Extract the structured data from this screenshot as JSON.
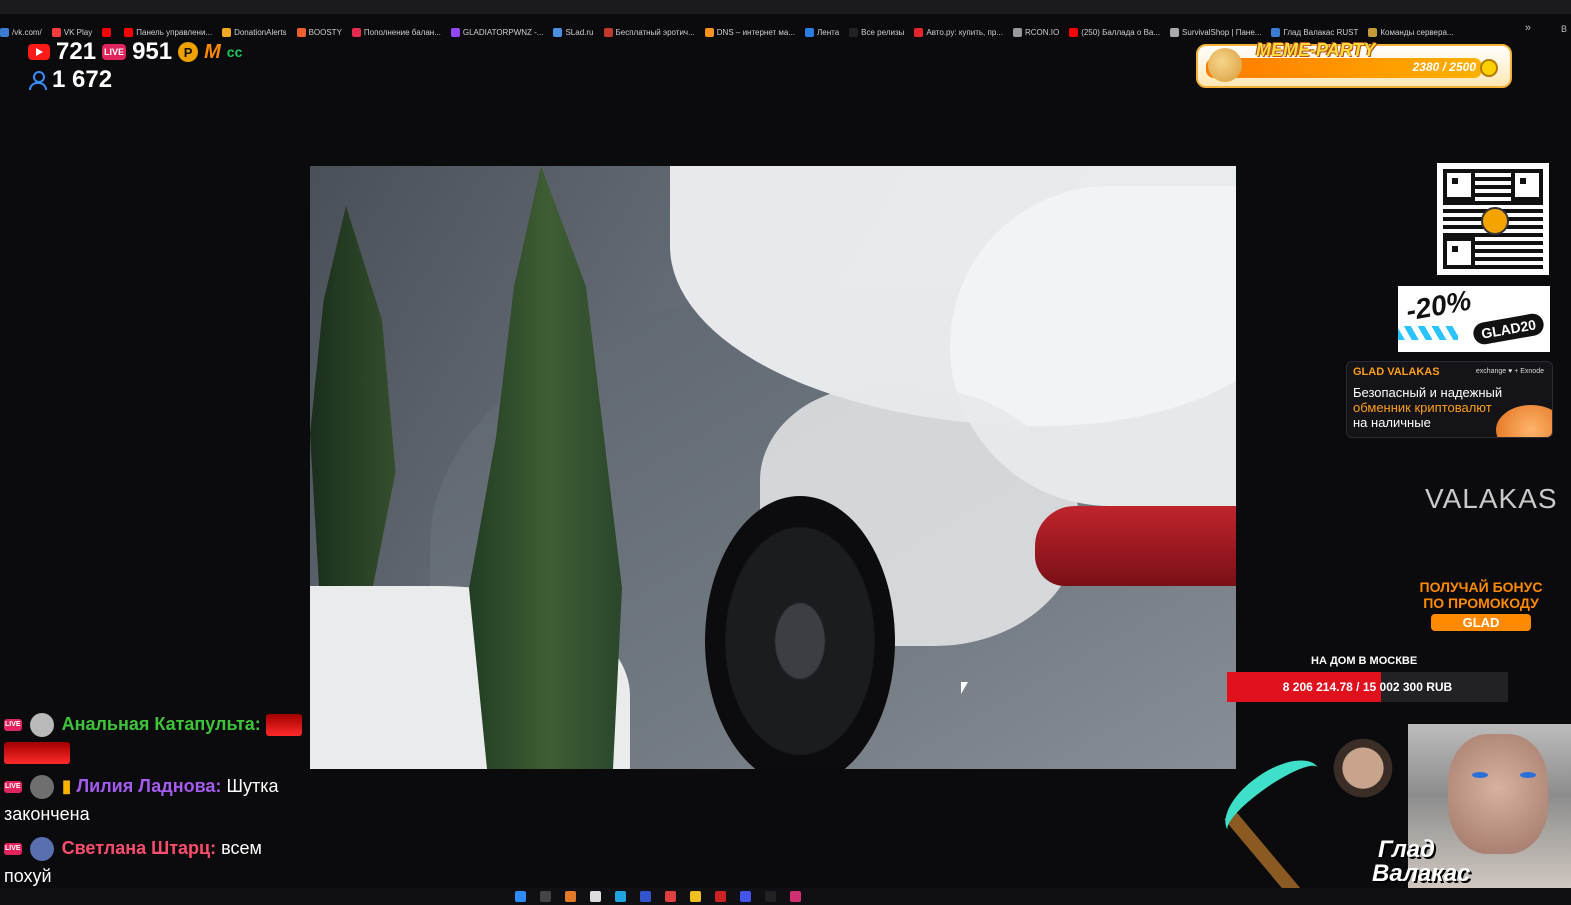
{
  "bookmarks": [
    {
      "label": "/vk.com/",
      "color": "#3a7bd5"
    },
    {
      "label": "VK Play",
      "color": "#ff3b3b"
    },
    {
      "label": "",
      "color": "#ff0000"
    },
    {
      "label": "Панель управлени...",
      "color": "#ff0000"
    },
    {
      "label": "DonationAlerts",
      "color": "#f5a623"
    },
    {
      "label": "BOOSTY",
      "color": "#f15f2c"
    },
    {
      "label": "Пополнение балан...",
      "color": "#e52b50"
    },
    {
      "label": "GLADIATORPWNZ -...",
      "color": "#9146ff"
    },
    {
      "label": "SLad.ru",
      "color": "#4a90e2"
    },
    {
      "label": "Бесплатный эротич...",
      "color": "#c0392b"
    },
    {
      "label": "DNS – интернет ма...",
      "color": "#f7931e"
    },
    {
      "label": "Лента",
      "color": "#2a7de1"
    },
    {
      "label": "Все релизы",
      "color": "#222222"
    },
    {
      "label": "Авто.ру: купить, пр...",
      "color": "#e3262b"
    },
    {
      "label": "RCON.IO",
      "color": "#999999"
    },
    {
      "label": "(250) Баллада о Ва...",
      "color": "#ff0000"
    },
    {
      "label": "SurvivalShop | Пане...",
      "color": "#aaaaaa"
    },
    {
      "label": "Глад Валакас RUST",
      "color": "#3a7bd5"
    },
    {
      "label": "Команды сервера...",
      "color": "#c49a3a"
    }
  ],
  "bookmarks_more": "»",
  "bookmarks_folder": "В",
  "stats": {
    "youtube_viewers": "721",
    "vkplay_live_badge": "LIVE",
    "vkplay_viewers": "951",
    "total_viewers": "1 672",
    "p_badge": "P",
    "m_badge": "M",
    "cc_badge": "cc"
  },
  "meme_party": {
    "title": "MEME-PARTY",
    "count": "2380 / 2500",
    "progress": 0.952
  },
  "promo20": {
    "percent": "-20%",
    "code": "GLAD20"
  },
  "exchange": {
    "header": "GLAD VALAKAS",
    "tag": "exchange ♥ + Exnode",
    "line1": "Безопасный и надежный",
    "line2": "обменник криптовалют",
    "line3": "на наличные"
  },
  "valakas_logo": "VALAKAS",
  "bonus": {
    "line1": "ПОЛУЧАЙ БОНУС",
    "line2": "ПО ПРОМОКОДУ",
    "code": "GLAD"
  },
  "house_goal": {
    "title": "НА ДОМ В МОСКВЕ",
    "text": "8 206 214.78 / 15 002 300 RUB",
    "progress": 0.547
  },
  "chat": [
    {
      "badge": "LIVE",
      "nick": "Анальная Катапульта:",
      "text": "",
      "avatar_color": "#b9b9b9",
      "has_emote": true
    },
    {
      "badge": "LIVE",
      "nick": "Лилия Ладнова:",
      "text": "Шутка закончена",
      "avatar_color": "#6f6f6f",
      "has_emote": false
    },
    {
      "badge": "LIVE",
      "nick": "Светлана Штарц:",
      "text": "всем похуй",
      "avatar_color": "#5a6fb0",
      "has_emote": false
    }
  ],
  "name_tag": {
    "line1": "Глад",
    "line2": "Валакас"
  }
}
